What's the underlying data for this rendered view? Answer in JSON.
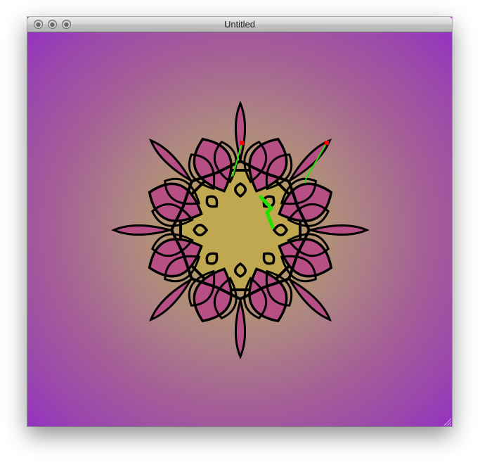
{
  "window": {
    "title": "Untitled",
    "controls": [
      "close-button",
      "minimize-button",
      "zoom-button"
    ]
  },
  "colors": {
    "background_center": "#c0a758",
    "background_edge": "#9433c0",
    "petal_fill": "#b84f84",
    "center_fill": "#c0a850",
    "stroke": "#000000",
    "highlight_line": "#22e000",
    "handle": "#ff0000"
  },
  "drawing": {
    "shape": "eight-fold rosette",
    "symmetry": 8
  }
}
